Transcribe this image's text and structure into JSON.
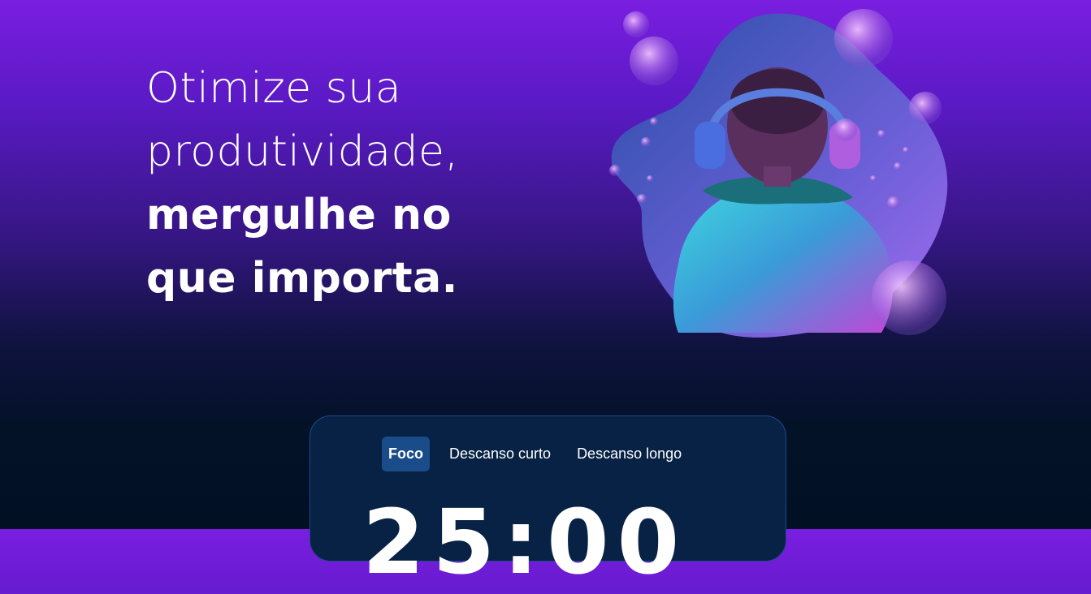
{
  "hero": {
    "line1": "Otimize sua",
    "line2": "produtividade,",
    "line3": "mergulhe no",
    "line4": "que importa."
  },
  "timer": {
    "tabs": [
      {
        "label": "Foco",
        "active": true
      },
      {
        "label": "Descanso curto",
        "active": false
      },
      {
        "label": "Descanso longo",
        "active": false
      }
    ],
    "display": "25:00"
  },
  "colors": {
    "gradient_top": "#7a1ee0",
    "gradient_bottom": "#021024",
    "card_bg": "#082245",
    "card_border": "#1b4a8e",
    "active_tab": "#1a4c8a"
  },
  "image": {
    "icon": "person-with-headphones-bubbles-illustration"
  }
}
